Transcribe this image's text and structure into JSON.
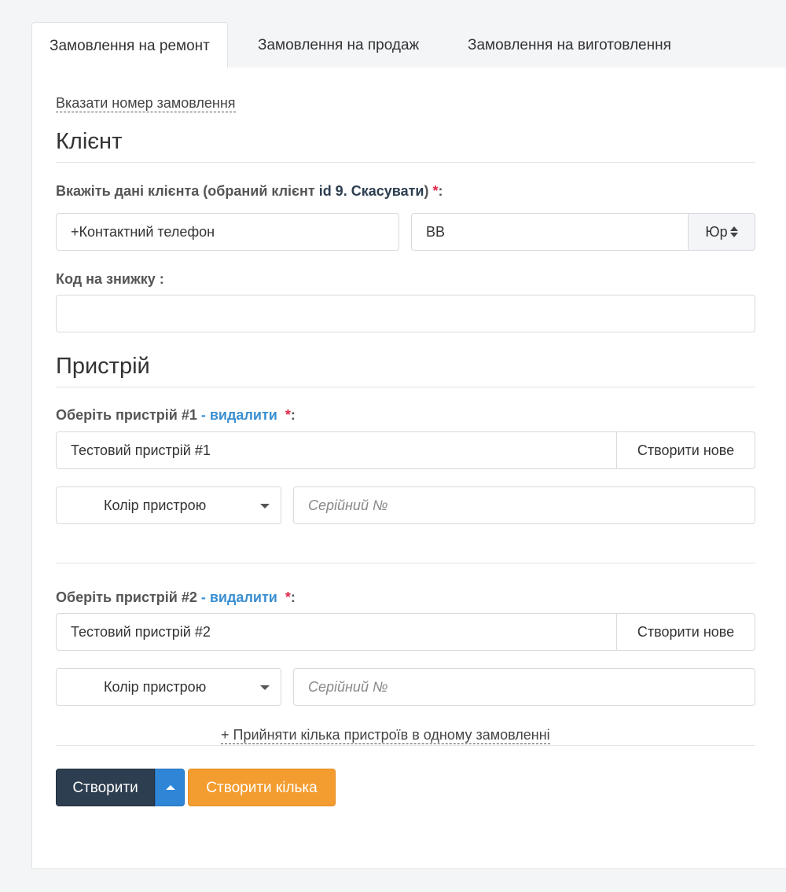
{
  "tabs": [
    {
      "label": "Замовлення на ремонт",
      "active": true
    },
    {
      "label": "Замовлення на продаж",
      "active": false
    },
    {
      "label": "Замовлення на виготовлення",
      "active": false
    }
  ],
  "order_number_link": "Вказати номер замовлення",
  "client": {
    "section_title": "Клієнт",
    "label_prefix": "Вкажіть дані клієнта (обраний клієнт ",
    "label_id": "id 9.",
    "label_cancel": "Скасувати",
    "label_suffix": ")",
    "required_mark": "*",
    "colon": ":",
    "phone_value": "+Контактний телефон",
    "name_value": "ВВ",
    "type_label": "Юр",
    "discount_label": "Код на знижку :",
    "discount_value": ""
  },
  "devices_section_title": "Пристрій",
  "devices": [
    {
      "label_prefix": "Оберіть пристрій #1",
      "delete_label": "- видалити",
      "required_mark": "*",
      "colon": ":",
      "device_value": "Тестовий пристрій #1",
      "create_new_label": "Створити нове",
      "color_label": "Колір пристрою",
      "serial_placeholder": "Серійний №"
    },
    {
      "label_prefix": "Оберіть пристрій #2",
      "delete_label": "- видалити",
      "required_mark": "*",
      "colon": ":",
      "device_value": "Тестовий пристрій #2",
      "create_new_label": "Створити нове",
      "color_label": "Колір пристрою",
      "serial_placeholder": "Серійний №"
    }
  ],
  "add_multiple_link": "+ Прийняти кілька пристроїв в одному замовленні",
  "actions": {
    "create_label": "Створити",
    "create_many_label": "Створити кілька"
  },
  "colors": {
    "primary_dark": "#2d3e50",
    "accent_blue": "#2f86d6",
    "accent_orange": "#f39c2f",
    "required_red": "#e0284a",
    "link_blue": "#3a8fd1"
  }
}
